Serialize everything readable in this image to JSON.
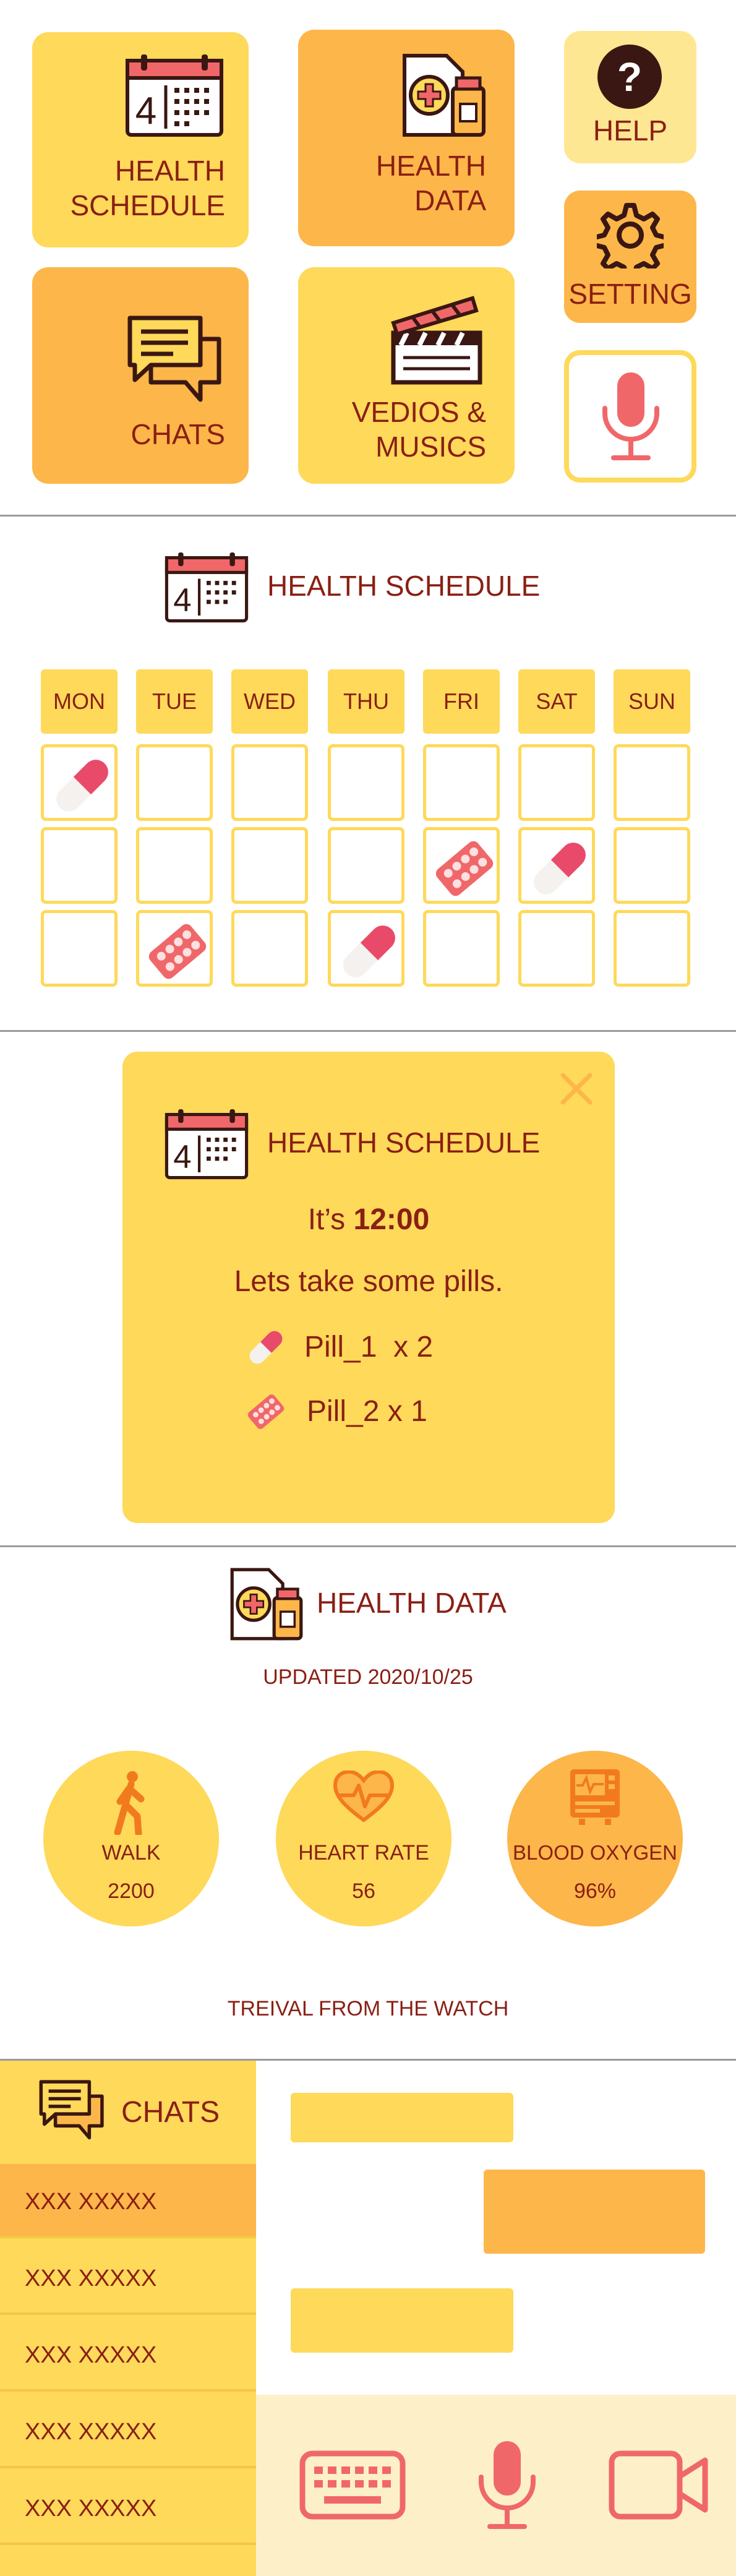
{
  "menu": {
    "health_schedule": [
      "HEALTH",
      "SCHEDULE"
    ],
    "health_data": [
      "HEALTH",
      "DATA"
    ],
    "help": "HELP",
    "chats": "CHATS",
    "videos_musics": [
      "VEDIOS &",
      "MUSICS"
    ],
    "setting": "SETTING"
  },
  "schedule": {
    "title": "HEALTH SCHEDULE",
    "calendar_day": "4",
    "days": [
      "MON",
      "TUE",
      "WED",
      "THU",
      "FRI",
      "SAT",
      "SUN"
    ],
    "grid": [
      [
        "capsule",
        "",
        "",
        "",
        "",
        "",
        ""
      ],
      [
        "",
        "",
        "",
        "",
        "tablet",
        "capsule",
        ""
      ],
      [
        "",
        "tablet",
        "",
        "capsule",
        "",
        "",
        ""
      ]
    ]
  },
  "reminder": {
    "title": "HEALTH SCHEDULE",
    "time_prefix": "It’s ",
    "time": "12:00",
    "message": "Lets take some pills.",
    "pills": [
      {
        "icon": "capsule",
        "text": "Pill_1  x 2"
      },
      {
        "icon": "tablet",
        "text": "Pill_2 x 1"
      }
    ]
  },
  "health_data": {
    "title": "HEALTH DATA",
    "updated": "UPDATED 2020/10/25",
    "metrics": [
      {
        "label": "WALK",
        "value": "2200",
        "icon": "walk-icon"
      },
      {
        "label": "HEART RATE",
        "value": "56",
        "icon": "heart-rate-icon"
      },
      {
        "label": "BLOOD OXYGEN",
        "value": "96%",
        "icon": "monitor-icon"
      }
    ],
    "footer": "TREIVAL FROM THE WATCH"
  },
  "chats": {
    "title": "CHATS",
    "contacts": [
      "XXX XXXXX",
      "XXX XXXXX",
      "XXX XXXXX",
      "XXX XXXXX",
      "XXX XXXXX"
    ],
    "selected_index": 0
  },
  "colors": {
    "yellow": "#fed95a",
    "orange": "#fdb649",
    "pale_yellow": "#fee792",
    "text": "#8a1f14",
    "coral": "#f0676a"
  }
}
